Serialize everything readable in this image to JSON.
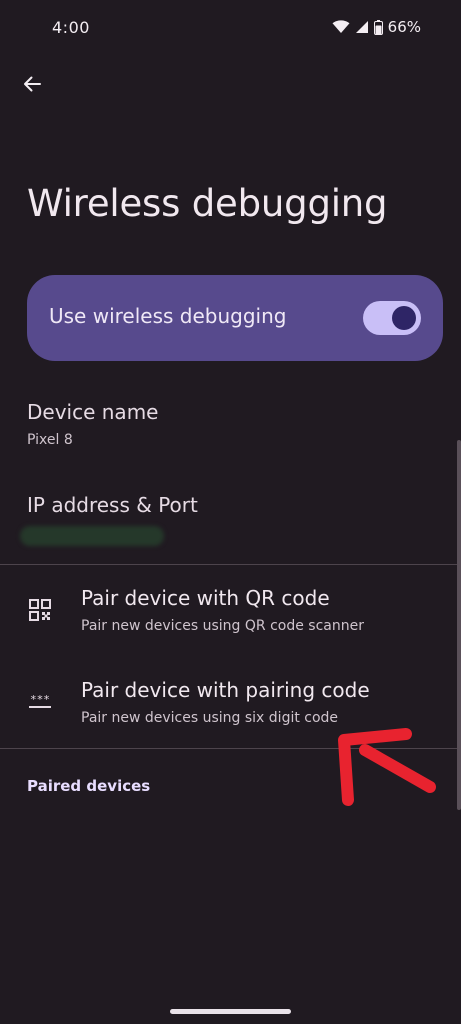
{
  "status_bar": {
    "time": "4:00",
    "battery": "66%",
    "icons": [
      "wifi-icon",
      "signal-icon",
      "battery-icon"
    ]
  },
  "toolbar": {
    "back_icon": "arrow-back-icon"
  },
  "page": {
    "title": "Wireless debugging"
  },
  "main_switch": {
    "label": "Use wireless debugging",
    "enabled": true,
    "color": "#574a8d"
  },
  "device_name": {
    "title": "Device name",
    "value": "Pixel 8"
  },
  "ip_address": {
    "title": "IP address & Port"
  },
  "pair_options": [
    {
      "icon": "qr-code-icon",
      "title": "Pair device with QR code",
      "summary": "Pair new devices using QR code scanner"
    },
    {
      "icon": "password-dots-icon",
      "title": "Pair device with pairing code",
      "summary": "Pair new devices using six digit code"
    }
  ],
  "paired_devices": {
    "header": "Paired devices"
  },
  "annotation": {
    "type": "red-arrow",
    "color": "#e8232f"
  }
}
